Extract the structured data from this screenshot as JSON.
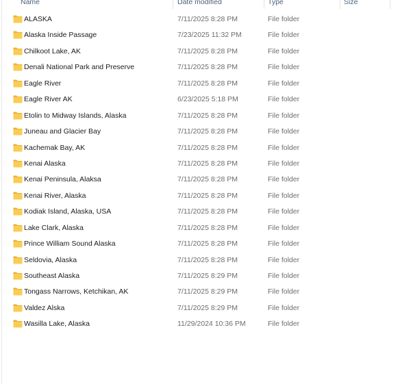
{
  "columns": {
    "name": "Name",
    "date_modified": "Date modified",
    "type": "Type",
    "size": "Size"
  },
  "colors": {
    "folder_body": "#f8cd52",
    "folder_tab": "#e8b33a",
    "header_text": "#4c607a",
    "name_text": "#1b1b1b",
    "secondary_text": "#6d6d6d"
  },
  "rows": [
    {
      "name": "ALASKA",
      "date": "7/11/2025 8:28 PM",
      "type": "File folder"
    },
    {
      "name": "Alaska Inside Passage",
      "date": "7/23/2025 11:32 PM",
      "type": "File folder"
    },
    {
      "name": "Chilkoot Lake, AK",
      "date": "7/11/2025 8:28 PM",
      "type": "File folder"
    },
    {
      "name": "Denali National Park and Preserve",
      "date": "7/11/2025 8:28 PM",
      "type": "File folder"
    },
    {
      "name": "Eagle River",
      "date": "7/11/2025 8:28 PM",
      "type": "File folder"
    },
    {
      "name": "Eagle River AK",
      "date": "6/23/2025 5:18 PM",
      "type": "File folder"
    },
    {
      "name": "Etolin to Midway Islands, Alaska",
      "date": "7/11/2025 8:28 PM",
      "type": "File folder"
    },
    {
      "name": "Juneau and Glacier Bay",
      "date": "7/11/2025 8:28 PM",
      "type": "File folder"
    },
    {
      "name": "Kachemak Bay, AK",
      "date": "7/11/2025 8:28 PM",
      "type": "File folder"
    },
    {
      "name": "Kenai Alaska",
      "date": "7/11/2025 8:28 PM",
      "type": "File folder"
    },
    {
      "name": "Kenai Peninsula, Alaksa",
      "date": "7/11/2025 8:28 PM",
      "type": "File folder"
    },
    {
      "name": "Kenai River, Alaska",
      "date": "7/11/2025 8:28 PM",
      "type": "File folder"
    },
    {
      "name": "Kodiak Island, Alaska, USA",
      "date": "7/11/2025 8:28 PM",
      "type": "File folder"
    },
    {
      "name": "Lake Clark, Alaska",
      "date": "7/11/2025 8:28 PM",
      "type": "File folder"
    },
    {
      "name": "Prince William Sound Alaska",
      "date": "7/11/2025 8:28 PM",
      "type": "File folder"
    },
    {
      "name": "Seldovia, Alaska",
      "date": "7/11/2025 8:28 PM",
      "type": "File folder"
    },
    {
      "name": "Southeast Alaska",
      "date": "7/11/2025 8:29 PM",
      "type": "File folder"
    },
    {
      "name": "Tongass Narrows, Ketchikan, AK",
      "date": "7/11/2025 8:29 PM",
      "type": "File folder"
    },
    {
      "name": "Valdez Alska",
      "date": "7/11/2025 8:29 PM",
      "type": "File folder"
    },
    {
      "name": "Wasilla Lake, Alaska",
      "date": "11/29/2024 10:36 PM",
      "type": "File folder"
    }
  ]
}
